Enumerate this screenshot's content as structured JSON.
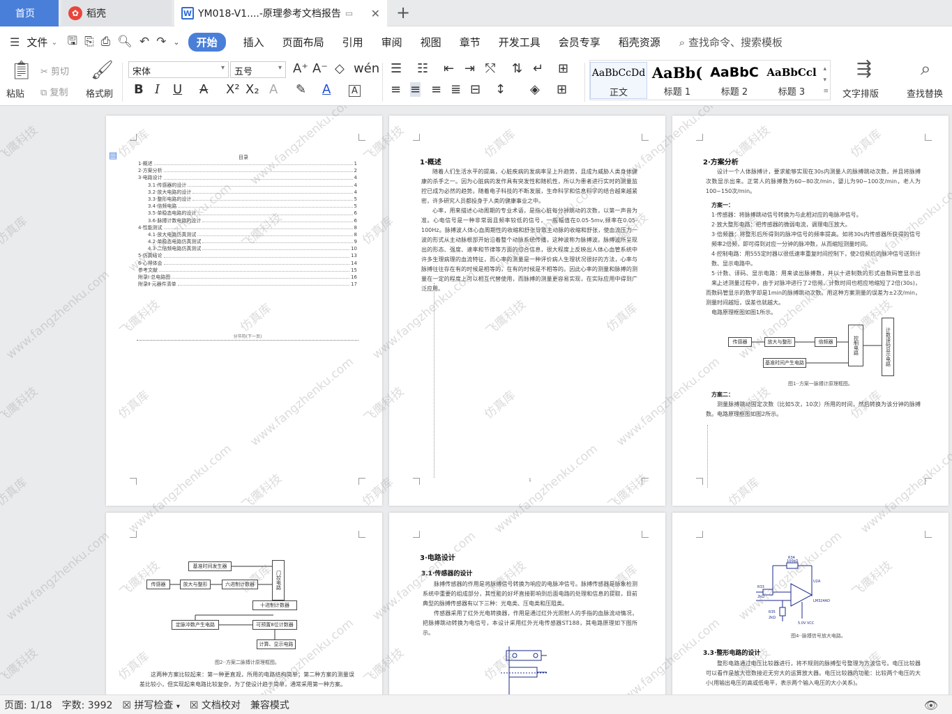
{
  "tabs": {
    "home": "首页",
    "daoke": "稻壳",
    "doc": "YM018-V1....-原理参考文档报告"
  },
  "menu": {
    "file": "文件",
    "items": [
      "开始",
      "插入",
      "页面布局",
      "引用",
      "审阅",
      "视图",
      "章节",
      "开发工具",
      "会员专享",
      "稻壳资源"
    ],
    "search": "查找命令、搜索模板"
  },
  "ribbon": {
    "paste": "粘贴",
    "cut": "剪切",
    "copy": "复制",
    "format_painter": "格式刷",
    "font_name": "宋体",
    "font_size": "五号",
    "text_layout": "文字排版",
    "find_replace": "查找替换",
    "styles": [
      {
        "preview": "AaBbCcDd",
        "name": "正文"
      },
      {
        "preview": "AaBb(",
        "name": "标题 1"
      },
      {
        "preview": "AaBbC",
        "name": "标题 2"
      },
      {
        "preview": "AaBbCcl",
        "name": "标题 3"
      }
    ]
  },
  "watermark": [
    "飞鹰科技",
    "仿真库",
    "www.fangzhenku.com"
  ],
  "pages": {
    "p1": {
      "title": "目录",
      "toc": [
        {
          "t": "1·概述",
          "p": "1"
        },
        {
          "t": "2·方案分析",
          "p": "2"
        },
        {
          "t": "3·电路设计",
          "p": "4"
        },
        {
          "t": "3.1·传感器的设计",
          "p": "4"
        },
        {
          "t": "3.2·放大电路的设计",
          "p": "4"
        },
        {
          "t": "3.3·整形电路的设计",
          "p": "5"
        },
        {
          "t": "3.4·倍频电路",
          "p": "5"
        },
        {
          "t": "3.5·单稳态电路的设计",
          "p": "6"
        },
        {
          "t": "3.6·脉搏计数电路的设计",
          "p": "6"
        },
        {
          "t": "4·性能测试",
          "p": "8"
        },
        {
          "t": "4.1·放大电路仿真测试",
          "p": "8"
        },
        {
          "t": "4.2·单稳态电路仿真测试",
          "p": "9"
        },
        {
          "t": "4.3·二倍频电路仿真测试",
          "p": "10"
        },
        {
          "t": "5·仿真结论",
          "p": "13"
        },
        {
          "t": "6·心得体会",
          "p": "14"
        },
        {
          "t": "参考文献",
          "p": "15"
        },
        {
          "t": "附录Ⅰ·总电路图",
          "p": "16"
        },
        {
          "t": "附录Ⅱ·元器件清单",
          "p": "17"
        }
      ],
      "section_break": "分节符(下一页)"
    },
    "p2": {
      "heading": "1·概述",
      "para1": "随着人们生活水平的提高，心脏疾病的发病率呈上升趋势，且成为威胁人类身体健康的杀手之一。因为心脏病的发作具有突发性和随机性，所以为患者进行实时的测量监控已成为必然的趋势。随着电子科技的不断发展，生命科学和信息科学的结合越来越紧密，许多研究人员都投身于人类的健康事业之中。",
      "para2": "心率，用来描述心动周期的专业术语，是指心脏每分钟跳动的次数，以第一声音为准。心电信号是一种非常弱且频率较低的信号，一般幅值在0.05-5mv,频率在0.05-100Hz。脉搏波人体心血周期性的收缩和舒张导致主动脉的收缩和舒张，使血流压力一波的形式从主动脉根部开始沿着整个动脉系统传播，这种波称为脉搏波。脉搏波所呈现出的形态、强度、速率和节律等方面的综合信息，很大程度上反映出人体心血管系统中许多生理病理的血流特征，而心率的测量是一种评价病人生理状况很好的方法，心率与脉搏往往存在有的时候是相等的，在有的时候是不相等的。因此心率的测量和脉搏的测量在一定的程度上可以相互代替使用，而脉搏的测量更容易实现，在实际应用中得到广泛应用。"
    },
    "p3": {
      "heading": "2·方案分析",
      "intro": "设计一个人体脉搏计，要求能够实现在30s内测量人的脉搏跳动次数，并且将脉搏次数显示出来。正常人的脉搏数为60~80次/min，婴儿为90~100次/min，老人为100~150次/min。",
      "scheme1": "方案一：",
      "items": [
        "1·传感器：将脉搏跳动信号转换为与此相对应的电脉冲信号。",
        "2·放大整形电路：把传感器的微弱电流，调理电压放大。",
        "3·倍频器：将整形后所得到的脉冲信号的频率提高。如将30s内传感器所获得的信号频率2倍频，即可得到对应一分钟的脉冲数，从而缩短测量时间。",
        "4·控制电路：用555定时器以很低速率重复时间控制下，使2倍频后的脉冲信号送到计数、显示电路中。",
        "5·计数、译码、显示电路：用来读出脉搏数，并以十进制数的形式由数码管显示出来。"
      ],
      "note": "上述测量过程中，由于对脉冲进行了2倍频，计数时间也相应地缩短了2倍(30s)，而数码管显示的数字却是1min的脉搏跳动次数。用这种方案测量的误差为±2次/min，测量时间越短，误差也就越大。",
      "fig_intro": "电路原理框图如图1所示。",
      "diagram": {
        "sensor": "传感器",
        "amp": "放大与整形",
        "dbl": "倍频器",
        "ctrl": "控制电路",
        "count": "计数译码显示电路",
        "base": "基准时间产生电路"
      },
      "fig1": "图1··方案一脉搏计原理框图。",
      "scheme2": "方案二：",
      "s2text": "测量脉搏跳动固定次数（比如5次，10次）所用的时间，然后转换为该分钟的脉搏数。电路原理框图如图2所示。"
    },
    "p4": {
      "diagram": {
        "base": "基准时间发生器",
        "sensor": "传感器",
        "amp": "放大与整形",
        "hex": "六进制计数器",
        "gate": "门控电路",
        "cnt": "十进制计数器",
        "pulse": "定脉冲数产生电路",
        "div": "可预置8位计数器",
        "calc": "计算、显示电路"
      },
      "fig2": "图2··方案二脉搏计原理框图。",
      "text": "这两种方案比较起来：第一种更直观，所用的电路结构简单；第二种方案的测量误差比较小，但实现起来电路比较复杂，为了使设计趋于简单，通常采用第一种方案。"
    },
    "p5": {
      "heading": "3·电路设计",
      "sub": "3.1·传感器的设计",
      "para1": "脉搏传感器的作用是将脉搏信号转换为响应的电脉冲信号。脉搏传感器是脉象检测系统中重要的组成部分，其性能的好坏直接影响到后面电路的处理和信息的提取，目前典型的脉搏传感器有以下三种：光电类、压电类和压阻类。",
      "para2": "传感器采用了红外光电转换器，作用是通过红外光照射人的手指的血脉流动情况，把脉搏跳动转换为电信号，本设计采用红外光电传感器ST188，其电路原理如下图所示。"
    },
    "p6": {
      "labels": {
        "r": "R34",
        "rv": "100kΩ",
        "u": "U2A",
        "opamp": "LM324AD",
        "vcc": "5.0V VCC",
        "r2": "R33",
        "r2v": "2kΩ",
        "r3": "R35",
        "r3v": "2kΩ"
      },
      "fig4": "图4··脉搏信号放大电路。",
      "sub": "3.3·整形电路的设计",
      "para": "整形电路通过电压比较器进行，将不规则的脉搏型号整理为方波信号。电压比较器可以看作是放大倍数接近无穷大的运算放大器。电压比较器的功能：比较两个电压的大小(用输出电压的高或低电平，表示两个输入电压的大小关系)。"
    },
    "marker_1": "1"
  },
  "status": {
    "page": "页面: 1/18",
    "words": "字数: 3992",
    "spell": "拼写检查",
    "proof": "文档校对",
    "compat": "兼容模式"
  }
}
